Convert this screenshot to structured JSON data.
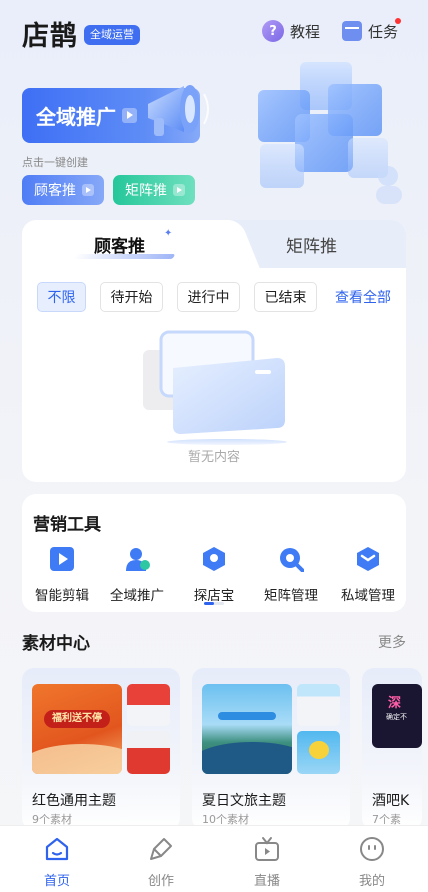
{
  "header": {
    "logo": "店鹊",
    "logo_badge": "全域运营",
    "tutorial_label": "教程",
    "task_label": "任务"
  },
  "hero": {
    "main_button": "全域推广",
    "hint": "点击一键创建",
    "pill_a": "顾客推",
    "pill_b": "矩阵推"
  },
  "tabs": {
    "items": [
      "顾客推",
      "矩阵推"
    ],
    "active_index": 0,
    "filters": [
      "不限",
      "待开始",
      "进行中",
      "已结束"
    ],
    "active_filter": "不限",
    "view_all": "查看全部",
    "empty_text": "暂无内容"
  },
  "tools": {
    "title": "营销工具",
    "items": [
      {
        "label": "智能剪辑",
        "icon": "play-video-icon"
      },
      {
        "label": "全域推广",
        "icon": "user-promote-icon"
      },
      {
        "label": "探店宝",
        "icon": "location-pin-icon"
      },
      {
        "label": "矩阵管理",
        "icon": "search-magnify-icon"
      },
      {
        "label": "私域管理",
        "icon": "cube-icon"
      }
    ]
  },
  "materials": {
    "title": "素材中心",
    "more": "更多",
    "cards": [
      {
        "name": "红色通用主题",
        "count": "9个素材",
        "banner_text": "福利送不停"
      },
      {
        "name": "夏日文旅主题",
        "count": "10个素材"
      },
      {
        "name": "酒吧K",
        "count": "7个素",
        "banner_text": "深",
        "sub_text": "确定不"
      }
    ]
  },
  "bottom_nav": {
    "items": [
      "首页",
      "创作",
      "直播",
      "我的"
    ],
    "active_index": 0
  },
  "colors": {
    "primary": "#2f63ee",
    "green": "#25c79a",
    "badge_red": "#ff3333"
  }
}
